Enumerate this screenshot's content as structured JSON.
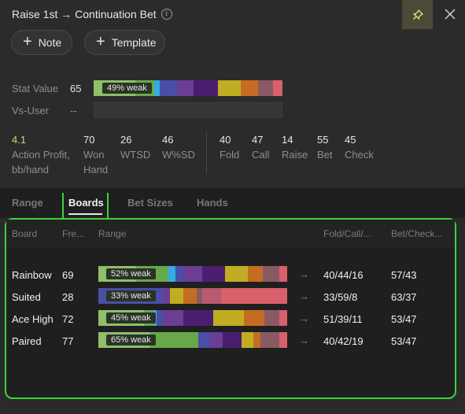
{
  "title": "Raise 1st → Continuation Bet",
  "info_icon": "info-icon",
  "pin_icon": "pin-icon",
  "close_icon": "close-icon",
  "buttons": {
    "note": "Note",
    "template": "Template",
    "plus_glyph": "+"
  },
  "stat_value": {
    "label": "Stat Value",
    "value": "65",
    "badge": "49% weak",
    "bar": [
      {
        "c": "#8fbf6a",
        "f": 0.22
      },
      {
        "c": "#67a84a",
        "f": 0.1
      },
      {
        "c": "#33aee0",
        "f": 0.03
      },
      {
        "c": "#4a4ea6",
        "f": 0.09
      },
      {
        "c": "#6a3e95",
        "f": 0.09
      },
      {
        "c": "#4a1e6e",
        "f": 0.13
      },
      {
        "c": "#c1ad22",
        "f": 0.12
      },
      {
        "c": "#c66c22",
        "f": 0.09
      },
      {
        "c": "#8a5a64",
        "f": 0.08
      },
      {
        "c": "#d9606a",
        "f": 0.05
      }
    ]
  },
  "vs_user": {
    "label": "Vs-User",
    "value": "--"
  },
  "stats_left": [
    {
      "value": "4.1",
      "label1": "Action Profit,",
      "label2": "bb/hand",
      "highlight": true
    },
    {
      "value": "70",
      "label1": "Won",
      "label2": "Hand"
    },
    {
      "value": "26",
      "label1": "WTSD",
      "label2": ""
    },
    {
      "value": "46",
      "label1": "W%SD",
      "label2": ""
    }
  ],
  "stats_right": [
    {
      "value": "40",
      "label": "Fold"
    },
    {
      "value": "47",
      "label": "Call"
    },
    {
      "value": "14",
      "label": "Raise"
    },
    {
      "value": "55",
      "label": "Bet"
    },
    {
      "value": "45",
      "label": "Check"
    }
  ],
  "tabs": [
    {
      "label": "Range",
      "active": false
    },
    {
      "label": "Boards",
      "active": true
    },
    {
      "label": "Bet Sizes",
      "active": false
    },
    {
      "label": "Hands",
      "active": false
    }
  ],
  "columns": {
    "board": "Board",
    "freq": "Fre...",
    "range": "Range",
    "fcr": "Fold/Call/...",
    "bc": "Bet/Check..."
  },
  "arrow_glyph": "→",
  "boards": [
    {
      "name": "Rainbow",
      "freq": "69",
      "badge": "52% weak",
      "fcr": "40/44/16",
      "bc": "57/43",
      "bar": [
        {
          "c": "#8fbf6a",
          "f": 0.2
        },
        {
          "c": "#67a84a",
          "f": 0.17
        },
        {
          "c": "#33aee0",
          "f": 0.04
        },
        {
          "c": "#4a4ea6",
          "f": 0.04
        },
        {
          "c": "#6a3e95",
          "f": 0.1
        },
        {
          "c": "#4a1e6e",
          "f": 0.12
        },
        {
          "c": "#c1ad22",
          "f": 0.12
        },
        {
          "c": "#c66c22",
          "f": 0.08
        },
        {
          "c": "#8a5a64",
          "f": 0.09
        },
        {
          "c": "#d9606a",
          "f": 0.04
        }
      ]
    },
    {
      "name": "Suited",
      "freq": "28",
      "badge": "33% weak",
      "fcr": "33/59/8",
      "bc": "63/37",
      "bar": [
        {
          "c": "#4a4ea6",
          "f": 0.34
        },
        {
          "c": "#6a3e95",
          "f": 0.04
        },
        {
          "c": "#c1ad22",
          "f": 0.07
        },
        {
          "c": "#c66c22",
          "f": 0.07
        },
        {
          "c": "#8a5a64",
          "f": 0.03
        },
        {
          "c": "#b85b6e",
          "f": 0.1
        },
        {
          "c": "#d9606a",
          "f": 0.35
        }
      ]
    },
    {
      "name": "Ace High",
      "freq": "72",
      "badge": "45% weak",
      "fcr": "51/39/11",
      "bc": "53/47",
      "bar": [
        {
          "c": "#8fbf6a",
          "f": 0.24
        },
        {
          "c": "#67a84a",
          "f": 0.05
        },
        {
          "c": "#33aee0",
          "f": 0.02
        },
        {
          "c": "#4a4ea6",
          "f": 0.03
        },
        {
          "c": "#6a3e95",
          "f": 0.11
        },
        {
          "c": "#4a1e6e",
          "f": 0.16
        },
        {
          "c": "#c1ad22",
          "f": 0.16
        },
        {
          "c": "#c66c22",
          "f": 0.11
        },
        {
          "c": "#8a5a64",
          "f": 0.08
        },
        {
          "c": "#d9606a",
          "f": 0.04
        }
      ]
    },
    {
      "name": "Paired",
      "freq": "77",
      "badge": "65% weak",
      "fcr": "40/42/19",
      "bc": "53/47",
      "bar": [
        {
          "c": "#8fbf6a",
          "f": 0.27
        },
        {
          "c": "#67a84a",
          "f": 0.26
        },
        {
          "c": "#4a4ea6",
          "f": 0.06
        },
        {
          "c": "#6a3e95",
          "f": 0.07
        },
        {
          "c": "#4a1e6e",
          "f": 0.1
        },
        {
          "c": "#c1ad22",
          "f": 0.06
        },
        {
          "c": "#c66c22",
          "f": 0.04
        },
        {
          "c": "#8a5a64",
          "f": 0.1
        },
        {
          "c": "#d9606a",
          "f": 0.04
        }
      ]
    }
  ]
}
